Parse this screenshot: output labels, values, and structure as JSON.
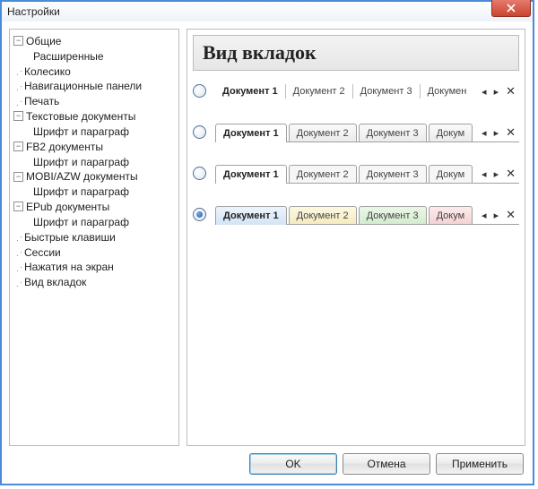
{
  "window": {
    "title": "Настройки"
  },
  "tree": {
    "n0": "Общие",
    "n0a": "Расширенные",
    "n1": "Колесико",
    "n2": "Навигационные панели",
    "n3": "Печать",
    "n4": "Текстовые документы",
    "n4a": "Шрифт и параграф",
    "n5": "FB2 документы",
    "n5a": "Шрифт и параграф",
    "n6": "MOBI/AZW документы",
    "n6a": "Шрифт и параграф",
    "n7": "EPub документы",
    "n7a": "Шрифт и параграф",
    "n8": "Быстрые клавиши",
    "n9": "Сессии",
    "n10": "Нажатия на экран",
    "n11": "Вид вкладок"
  },
  "heading": "Вид вкладок",
  "tabs": {
    "t1": "Документ 1",
    "t2": "Документ 2",
    "t3": "Документ 3",
    "t4s1": "Докумен",
    "t4s2": "Докум",
    "t4s3": "Докум",
    "t4s4": "Докум"
  },
  "buttons": {
    "ok": "OK",
    "cancel": "Отмена",
    "apply": "Применить"
  },
  "glyphs": {
    "minus": "−",
    "left": "◂",
    "right": "▸",
    "close": "✕"
  },
  "selected_style_index": 3
}
